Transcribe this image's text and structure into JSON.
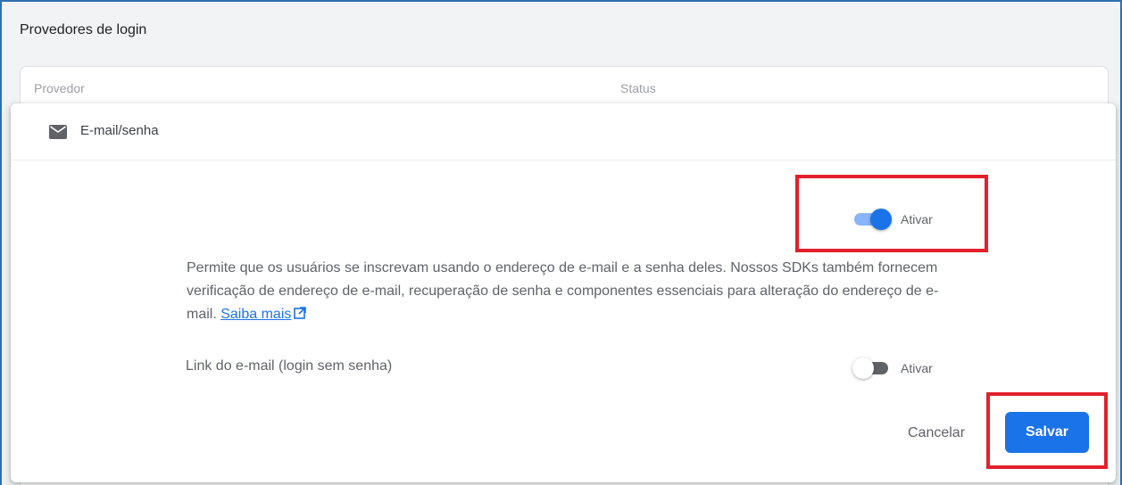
{
  "section": {
    "title": "Provedores de login"
  },
  "table": {
    "columns": [
      "Provedor",
      "Status"
    ]
  },
  "provider": {
    "icon": "mail-icon",
    "name": "E-mail/senha"
  },
  "enable_toggle": {
    "label": "Ativar",
    "state": "on"
  },
  "description": {
    "text": "Permite que os usuários se inscrevam usando o endereço de e-mail e a senha deles. Nossos SDKs também fornecem verificação de endereço de e-mail, recuperação de senha e componentes essenciais para alteração do endereço de e-mail. ",
    "link": "Saiba mais"
  },
  "email_link": {
    "label": "Link do e-mail (login sem senha)",
    "toggle_label": "Ativar",
    "state": "off"
  },
  "actions": {
    "cancel": "Cancelar",
    "save": "Salvar"
  },
  "colors": {
    "accent": "#1a73e8",
    "highlight": "#e3202b"
  }
}
